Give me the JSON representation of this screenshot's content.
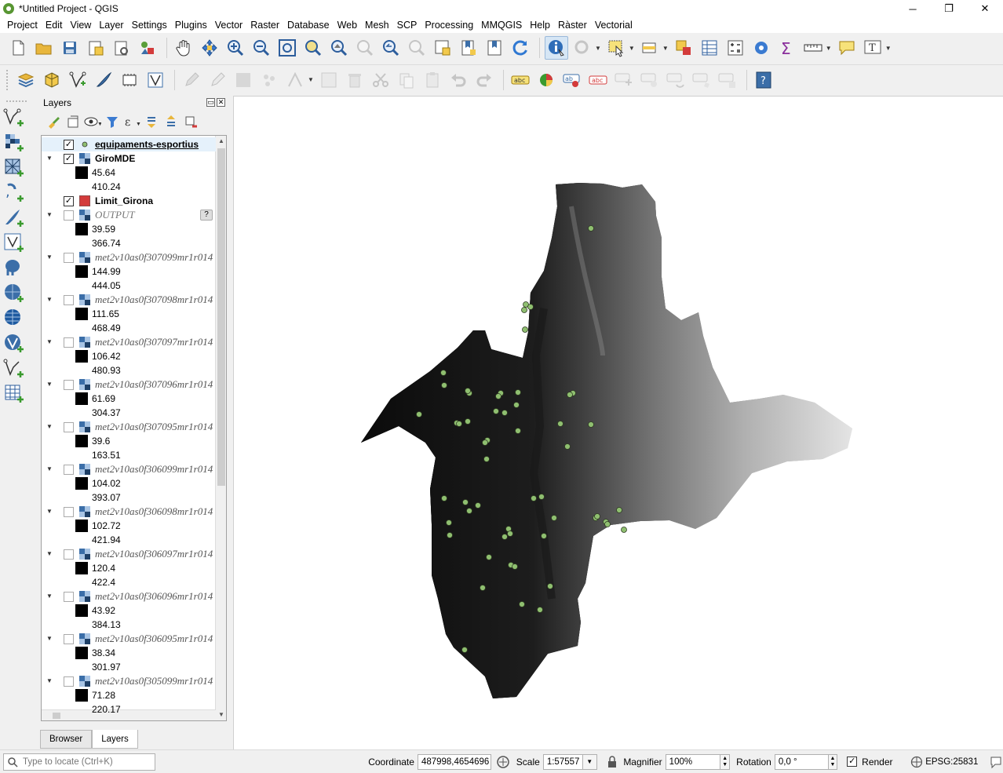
{
  "window": {
    "title": "*Untitled Project - QGIS",
    "minimize": "─",
    "maximize": "❐",
    "close": "✕"
  },
  "menu": [
    "Project",
    "Edit",
    "View",
    "Layer",
    "Settings",
    "Plugins",
    "Vector",
    "Raster",
    "Database",
    "Web",
    "Mesh",
    "SCP",
    "Processing",
    "MMQGIS",
    "Help",
    "Ràster",
    "Vectorial"
  ],
  "layers_panel": {
    "title": "Layers",
    "tabs": [
      "Browser",
      "Layers"
    ],
    "active_tab": "Layers",
    "entries": [
      {
        "name": "equipaments-esportius",
        "checked": true,
        "type": "point",
        "style": "bu",
        "selected": true
      },
      {
        "name": "GiroMDE",
        "checked": true,
        "type": "raster",
        "style": "bold",
        "expanded": true,
        "min": "45.64",
        "max": "410.24"
      },
      {
        "name": "Limit_Girona",
        "checked": true,
        "type": "polygon",
        "style": "bold"
      },
      {
        "name": "OUTPUT",
        "checked": false,
        "type": "raster",
        "style": "ital",
        "expanded": true,
        "min": "39.59",
        "max": "366.74",
        "badge": "?"
      },
      {
        "name": "met2v10as0f307099mr1r014",
        "checked": false,
        "type": "raster",
        "style": "ivis",
        "expanded": true,
        "min": "144.99",
        "max": "444.05"
      },
      {
        "name": "met2v10as0f307098mr1r014",
        "checked": false,
        "type": "raster",
        "style": "ivis",
        "expanded": true,
        "min": "111.65",
        "max": "468.49"
      },
      {
        "name": "met2v10as0f307097mr1r014",
        "checked": false,
        "type": "raster",
        "style": "ivis",
        "expanded": true,
        "min": "106.42",
        "max": "480.93"
      },
      {
        "name": "met2v10as0f307096mr1r014",
        "checked": false,
        "type": "raster",
        "style": "ivis",
        "expanded": true,
        "min": "61.69",
        "max": "304.37"
      },
      {
        "name": "met2v10as0f307095mr1r014",
        "checked": false,
        "type": "raster",
        "style": "ivis",
        "expanded": true,
        "min": "39.6",
        "max": "163.51"
      },
      {
        "name": "met2v10as0f306099mr1r014",
        "checked": false,
        "type": "raster",
        "style": "ivis",
        "expanded": true,
        "min": "104.02",
        "max": "393.07"
      },
      {
        "name": "met2v10as0f306098mr1r014",
        "checked": false,
        "type": "raster",
        "style": "ivis",
        "expanded": true,
        "min": "102.72",
        "max": "421.94"
      },
      {
        "name": "met2v10as0f306097mr1r014",
        "checked": false,
        "type": "raster",
        "style": "ivis",
        "expanded": true,
        "min": "120.4",
        "max": "422.4"
      },
      {
        "name": "met2v10as0f306096mr1r014",
        "checked": false,
        "type": "raster",
        "style": "ivis",
        "expanded": true,
        "min": "43.92",
        "max": "384.13"
      },
      {
        "name": "met2v10as0f306095mr1r014",
        "checked": false,
        "type": "raster",
        "style": "ivis",
        "expanded": true,
        "min": "38.34",
        "max": "301.97"
      },
      {
        "name": "met2v10as0f305099mr1r014",
        "checked": false,
        "type": "raster",
        "style": "ivis",
        "expanded": true,
        "min": "71.28",
        "max": "220.17"
      }
    ]
  },
  "status": {
    "locator_placeholder": "Type to locate (Ctrl+K)",
    "coordinate_label": "Coordinate",
    "coordinate_value": "487998,4654696",
    "scale_label": "Scale",
    "scale_value": "1:57557",
    "magnifier_label": "Magnifier",
    "magnifier_value": "100%",
    "rotation_label": "Rotation",
    "rotation_value": "0,0 °",
    "render_label": "Render",
    "render_checked": true,
    "crs": "EPSG:25831"
  },
  "colors": {
    "point_fill": "#8fbf70",
    "polygon_swatch": "#d33b3b",
    "selection": "#e5f1fb"
  }
}
